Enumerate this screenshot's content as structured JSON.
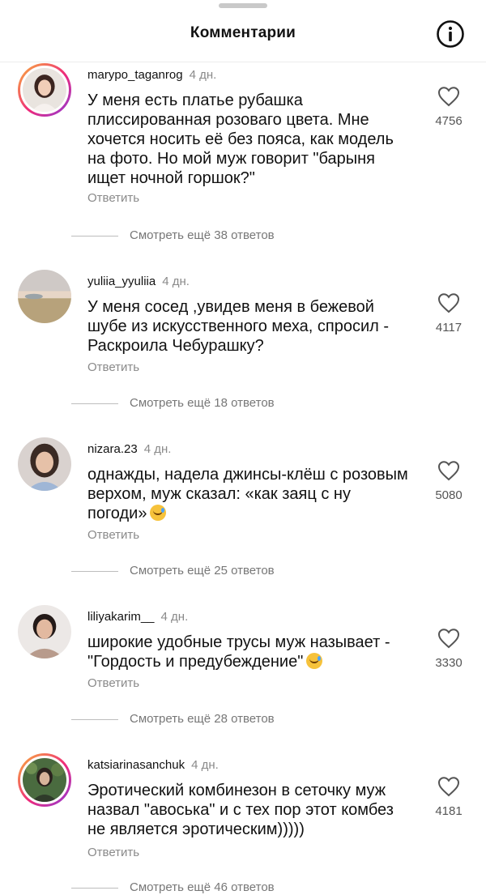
{
  "header": {
    "title": "Комментарии",
    "info_icon": "info-icon"
  },
  "comments": [
    {
      "username": "marypo_taganrog",
      "time": "4 дн.",
      "text": "У меня есть платье рубашка плиссированная розоваго цвета. Мне хочется носить её без пояса, как модель на фото. Но мой муж говорит \"барыня ищет ночной горшок?\"",
      "reply_label": "Ответить",
      "likes": "4756",
      "more_replies": "Смотреть ещё 38 ответов",
      "has_story_ring": true,
      "emoji": ""
    },
    {
      "username": "yuliia_yyuliia",
      "time": "4 дн.",
      "text": "У меня сосед ,увидев меня в бежевой шубе из искусственного меха, спросил - Раскроила Чебурашку?",
      "reply_label": "Ответить",
      "likes": "4117",
      "more_replies": "Смотреть ещё 18 ответов",
      "has_story_ring": false,
      "emoji": ""
    },
    {
      "username": "nizara.23",
      "time": "4 дн.",
      "text": "однажды, надела джинсы-клёш с розовым верхом, муж сказал: «как заяц с ну погоди»",
      "reply_label": "Ответить",
      "likes": "5080",
      "more_replies": "Смотреть ещё 25 ответов",
      "has_story_ring": false,
      "emoji": "sweat-smile-emoji"
    },
    {
      "username": "liliyakarim__",
      "time": "4 дн.",
      "text": "широкие удобные трусы муж называет - \"Гордость и предубеждение\"",
      "reply_label": "Ответить",
      "likes": "3330",
      "more_replies": "Смотреть ещё 28 ответов",
      "has_story_ring": false,
      "emoji": "laughing-tears-emoji"
    },
    {
      "username": "katsiarinasanchuk",
      "time": "4 дн.",
      "text": "Эротический комбинезон в сеточку муж назвал \"авоська\" и с тех пор этот комбез не является эротическим)))))",
      "reply_label": "Ответить",
      "likes": "4181",
      "more_replies": "Смотреть ещё 46 ответов",
      "has_story_ring": true,
      "emoji": ""
    }
  ]
}
